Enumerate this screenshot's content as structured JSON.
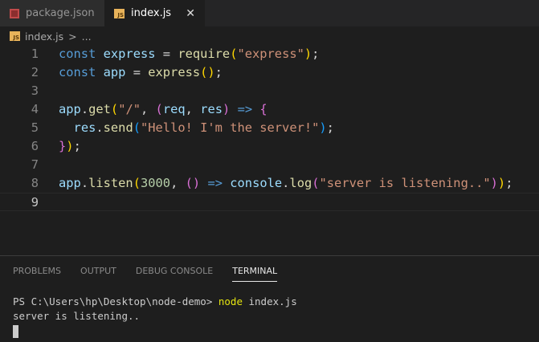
{
  "tabs": [
    {
      "label": "package.json",
      "icon": "json-file-icon"
    },
    {
      "label": "index.js",
      "icon": "js-file-icon"
    }
  ],
  "breadcrumb": {
    "file": "index.js",
    "sep": ">",
    "more": "..."
  },
  "js_badge": "JS",
  "code_lines": [
    [
      [
        "const",
        "kw"
      ],
      [
        " ",
        "op"
      ],
      [
        "express",
        "var"
      ],
      [
        " = ",
        "op"
      ],
      [
        "require",
        "fn"
      ],
      [
        "(",
        "b1"
      ],
      [
        "\"express\"",
        "str"
      ],
      [
        ")",
        "b1"
      ],
      [
        ";",
        "op"
      ]
    ],
    [
      [
        "const",
        "kw"
      ],
      [
        " ",
        "op"
      ],
      [
        "app",
        "var"
      ],
      [
        " = ",
        "op"
      ],
      [
        "express",
        "fn"
      ],
      [
        "()",
        "b1"
      ],
      [
        ";",
        "op"
      ]
    ],
    [],
    [
      [
        "app",
        "var"
      ],
      [
        ".",
        "op"
      ],
      [
        "get",
        "fn"
      ],
      [
        "(",
        "b1"
      ],
      [
        "\"/\"",
        "str"
      ],
      [
        ", ",
        "op"
      ],
      [
        "(",
        "b2"
      ],
      [
        "req",
        "var"
      ],
      [
        ", ",
        "op"
      ],
      [
        "res",
        "var"
      ],
      [
        ")",
        "b2"
      ],
      [
        " ",
        "op"
      ],
      [
        "=>",
        "kw"
      ],
      [
        " ",
        "op"
      ],
      [
        "{",
        "b2"
      ]
    ],
    [
      [
        "  ",
        "op"
      ],
      [
        "res",
        "var"
      ],
      [
        ".",
        "op"
      ],
      [
        "send",
        "fn"
      ],
      [
        "(",
        "b3"
      ],
      [
        "\"Hello! I'm the server!\"",
        "str"
      ],
      [
        ")",
        "b3"
      ],
      [
        ";",
        "op"
      ]
    ],
    [
      [
        "}",
        "b2"
      ],
      [
        ")",
        "b1"
      ],
      [
        ";",
        "op"
      ]
    ],
    [],
    [
      [
        "app",
        "var"
      ],
      [
        ".",
        "op"
      ],
      [
        "listen",
        "fn"
      ],
      [
        "(",
        "b1"
      ],
      [
        "3000",
        "num"
      ],
      [
        ", ",
        "op"
      ],
      [
        "()",
        "b2"
      ],
      [
        " ",
        "op"
      ],
      [
        "=>",
        "kw"
      ],
      [
        " ",
        "op"
      ],
      [
        "console",
        "var"
      ],
      [
        ".",
        "op"
      ],
      [
        "log",
        "fn"
      ],
      [
        "(",
        "b2"
      ],
      [
        "\"server is listening..\"",
        "str"
      ],
      [
        ")",
        "b2"
      ],
      [
        ")",
        "b1"
      ],
      [
        ";",
        "op"
      ]
    ],
    []
  ],
  "panel": {
    "tabs": [
      "PROBLEMS",
      "OUTPUT",
      "DEBUG CONSOLE",
      "TERMINAL"
    ],
    "active": "TERMINAL"
  },
  "terminal": {
    "prompt": "PS C:\\Users\\hp\\Desktop\\node-demo> ",
    "command": "node",
    "args": " index.js",
    "output": "server is listening.."
  }
}
